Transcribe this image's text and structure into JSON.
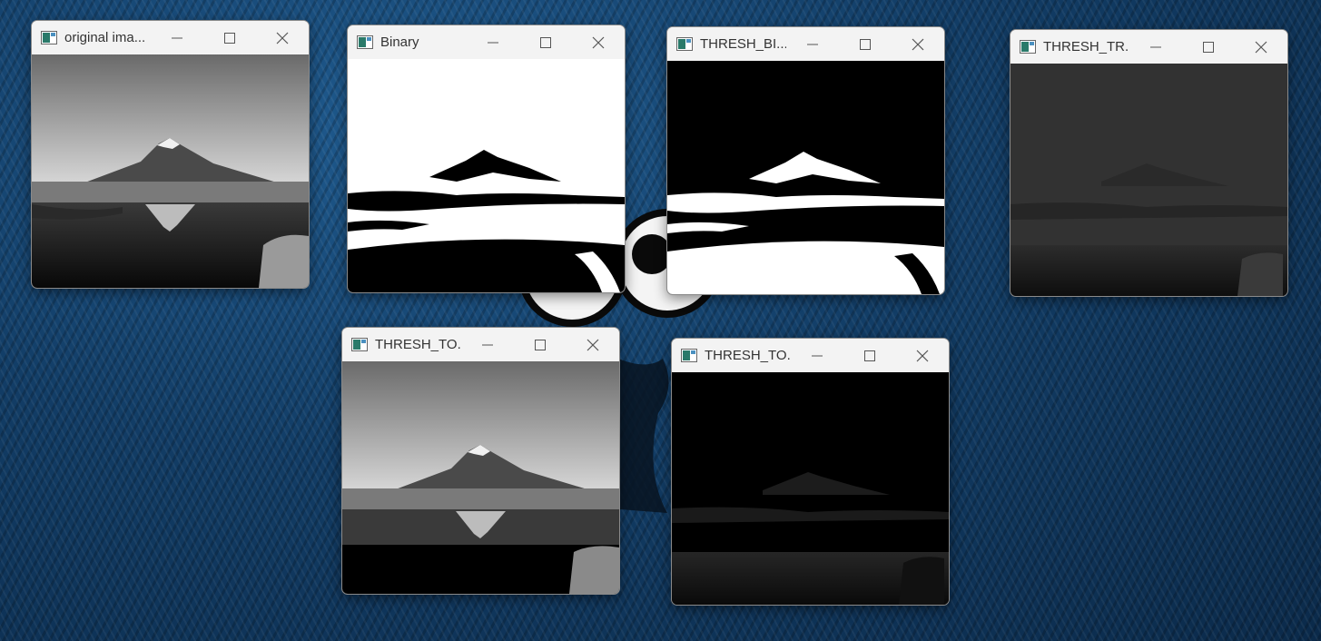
{
  "desktop": {
    "wallpaper": "blue-fur",
    "accent_color": "#123d66"
  },
  "windows": [
    {
      "id": "original",
      "title": "original ima..."
    },
    {
      "id": "binary",
      "title": "Binary"
    },
    {
      "id": "binary-inv",
      "title": "THRESH_BI..."
    },
    {
      "id": "trunc",
      "title": "THRESH_TR..."
    },
    {
      "id": "tozero",
      "title": "THRESH_TO..."
    },
    {
      "id": "tozero-inv",
      "title": "THRESH_TO..."
    }
  ],
  "icons": {
    "app": "opencv-window-icon",
    "minimize": "minimize-icon",
    "maximize": "maximize-icon",
    "close": "close-icon"
  }
}
